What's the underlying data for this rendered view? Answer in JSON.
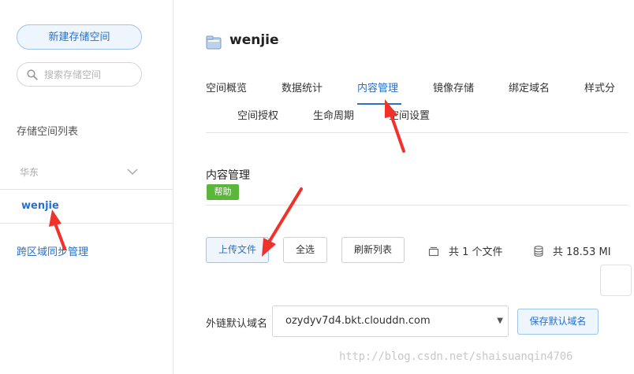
{
  "sidebar": {
    "new_bucket_label": "新建存储空间",
    "search_placeholder": "搜索存储空间",
    "list_title": "存储空间列表",
    "region_label": "华东",
    "bucket_name": "wenjie",
    "cross_region_label": "跨区域同步管理"
  },
  "header": {
    "bucket_title": "wenjie"
  },
  "tabs": {
    "row1": [
      "空间概览",
      "数据统计",
      "内容管理",
      "镜像存储",
      "绑定域名",
      "样式分"
    ],
    "row2": [
      "空间授权",
      "生命周期",
      "空间设置"
    ],
    "active": "内容管理"
  },
  "content": {
    "section_title": "内容管理",
    "help_label": "帮助",
    "upload_label": "上传文件",
    "select_all_label": "全选",
    "refresh_label": "刷新列表",
    "file_count_text": "共 1 个文件",
    "total_size_text": "共 18.53 MI"
  },
  "domain": {
    "label": "外链默认域名",
    "selected": "ozydyv7d4.bkt.clouddn.com",
    "save_label": "保存默认域名"
  },
  "watermark": "http://blog.csdn.net/shaisuanqin4706",
  "colors": {
    "accent": "#2a6fc9",
    "help_green": "#5bb63b",
    "annotation_red": "#f0322a"
  }
}
